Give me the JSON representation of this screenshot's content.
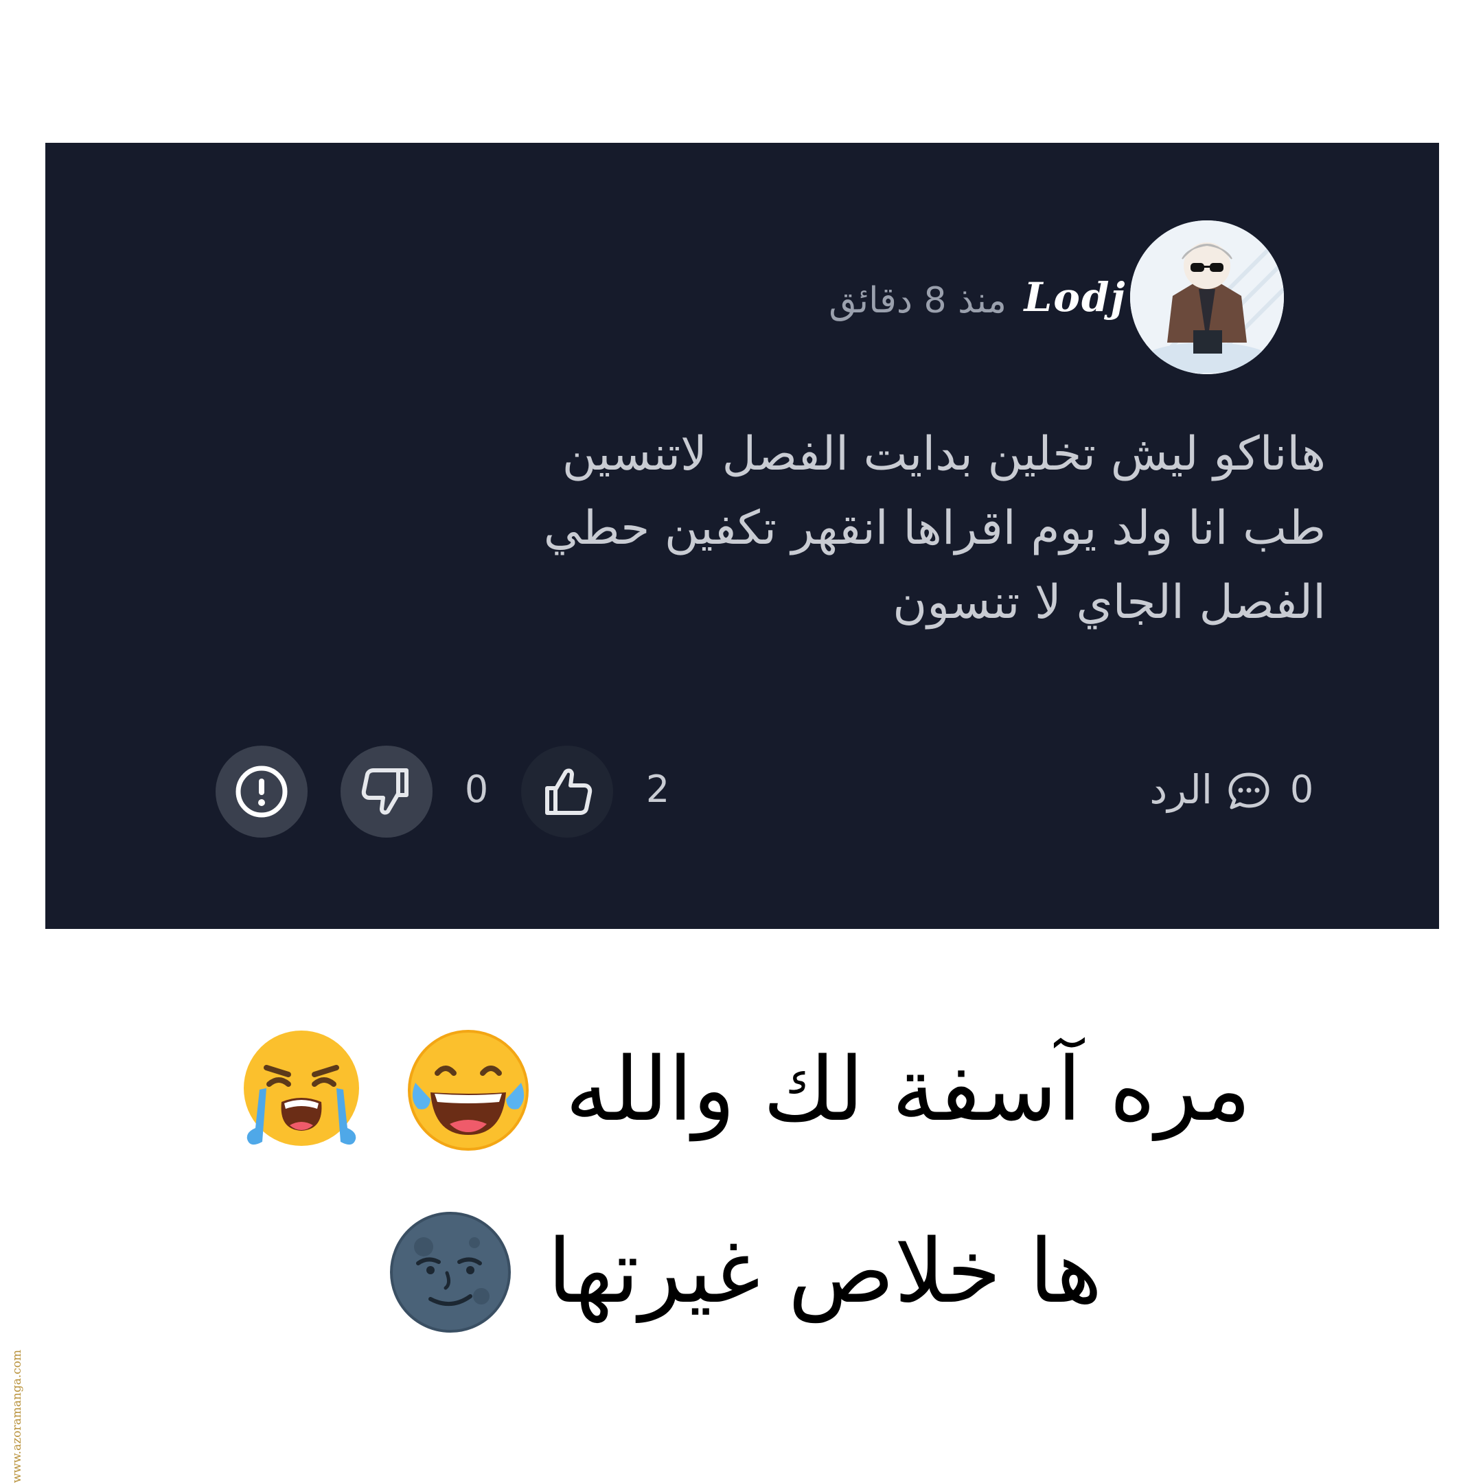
{
  "comment": {
    "username": "Lodj",
    "timestamp": "منذ 8 دقائق",
    "body_lines": [
      "هاناكو ليش تخلين بدايت الفصل لاتنسين",
      "طب انا ولد يوم اقراها انقهر تكفين حطي",
      "الفصل الجاي لا تنسون"
    ],
    "reply_label": "الرد",
    "reply_count": "0",
    "like_count": "2",
    "dislike_count": "0"
  },
  "caption": {
    "line1": "مره آسفة لك والله",
    "line2": "ها خلاص غيرتها"
  },
  "icons": {
    "avatar": "avatar-image",
    "reply": "comment-bubble-icon",
    "like": "thumbs-up-icon",
    "dislike": "thumbs-down-icon",
    "report": "exclamation-circle-icon",
    "emoji1": "laughing-tears-emoji",
    "emoji2": "loudly-crying-emoji",
    "emoji3": "new-moon-face-emoji"
  },
  "watermark": "www.azoramanga.com",
  "colors": {
    "card_background": "#161b2b",
    "text_muted": "#9aa0ad",
    "text_body": "#c9ccd3",
    "button_background": "#3a404e"
  }
}
